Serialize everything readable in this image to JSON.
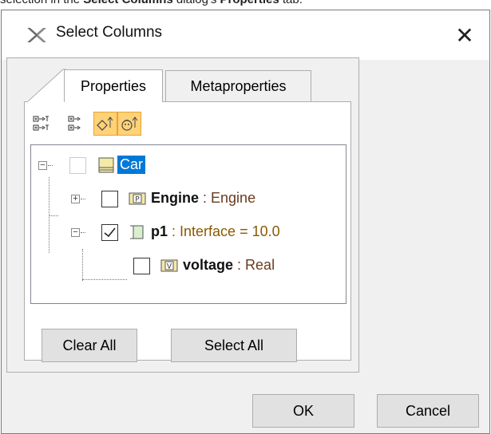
{
  "caption": {
    "prefix": "selection in the ",
    "dialog_name": "Select Columns",
    "middle": " dialog's ",
    "tab_name": "Properties",
    "suffix": " tab."
  },
  "dialog": {
    "title": "Select Columns",
    "close_glyph": "✕"
  },
  "tabs": [
    {
      "label": "Properties",
      "active": true
    },
    {
      "label": "Metaproperties",
      "active": false
    }
  ],
  "toolbar": [
    {
      "icon": "expand-all-icon",
      "pressed": false
    },
    {
      "icon": "expand-selected-icon",
      "pressed": false
    },
    {
      "icon": "show-inherited-icon",
      "pressed": true
    },
    {
      "icon": "show-hidden-icon",
      "pressed": true
    }
  ],
  "tree": {
    "root": {
      "label": "Car",
      "checked": false,
      "expander": "⊟"
    },
    "children": [
      {
        "name": "Engine",
        "sep": " : ",
        "type": "Engine",
        "checked": false,
        "expander": "⊞",
        "stereo": "P"
      },
      {
        "name": "p1",
        "sep": " : ",
        "type": "Interface = 10.0",
        "checked": true,
        "expander": "⊟"
      },
      {
        "name": "voltage",
        "sep": " : ",
        "type": "Real",
        "checked": false,
        "stereo": "V"
      }
    ]
  },
  "buttons": {
    "clear_all": "Clear All",
    "select_all": "Select All",
    "ok": "OK",
    "cancel": "Cancel"
  },
  "colors": {
    "selection": "#0078d7",
    "pressed_toggle": "#ffd277",
    "dialog_bg": "#f0f0f0"
  }
}
